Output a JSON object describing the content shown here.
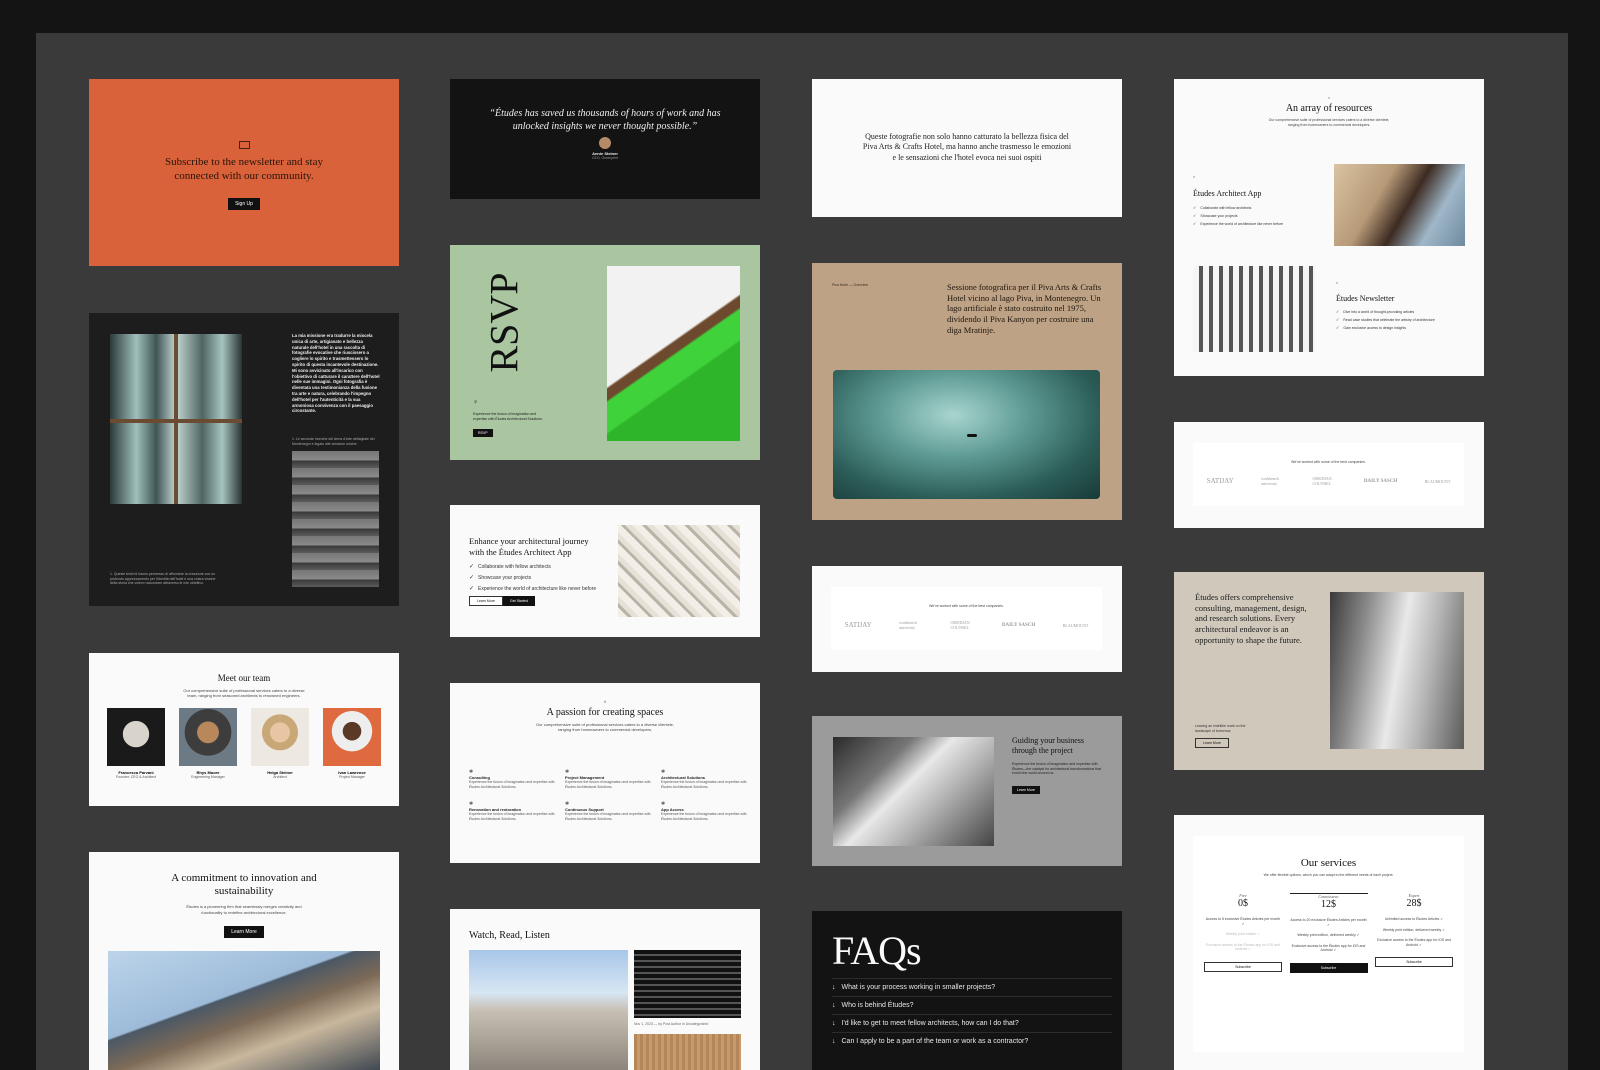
{
  "newsletter": {
    "title": "Subscribe to the newsletter and stay connected with our community.",
    "button": "Sign Up"
  },
  "testimonial": {
    "quote": "“Études has saved us thousands of hours of work and has unlocked insights we never thought possible.”",
    "name": "Annie Steiner",
    "role": "CEO, Greenprint"
  },
  "quote_it": {
    "text": "Queste fotografie non solo hanno catturato la bellezza fisica del Piva Arts & Crafts Hotel, ma hanno anche trasmesso le emozioni e le sensazioni che l'hotel evoca nei suoi ospiti"
  },
  "resources": {
    "title": "An array of resources",
    "subtitle": "Our comprehensive suite of professional services caters to a diverse clientele, ranging from homeowners to commercial developers.",
    "app_title": "Études Architect App",
    "app_items": [
      "Collaborate with fellow architects",
      "Showcase your projects",
      "Experience the world of architecture like never before"
    ],
    "newsletter_title": "Études Newsletter",
    "newsletter_items": [
      "Dive into a world of thought-provoking articles",
      "Read case studies that celebrate the artistry of architecture",
      "Gain exclusive access to design insights"
    ]
  },
  "mission": {
    "text": "La mia missione era tradurre la miscela unica di arte, artigianato e bellezza naturale dell'hotel in una raccolta di fotografie evocative che riuscissero a cogliere lo spirito e trasmettessero lo spirito di questa incantevole destinazione. Mi sono avvicinato all'incarico con l'obiettivo di catturare il carattere dell'hotel nelle sue immagini. Ogni fotografia è diventata una testimonianza della fusione tra arte e natura, celebrando l'impegno dell'hotel per l'autenticità e la sua armoniosa convivenza con il paesaggio circostante.",
    "caption_top": "1. Le seconde ricerche del Arma d'arte dettagliate del Montenegro e legato alle venature uniche.",
    "caption_bottom": "1. Queste testi mi hanno permesso di affrontare la creazione con un profondo apprezzamento per l'identità dell'hotel e una chiara visione della storia che volevo raccontare attraverso le mie obiettivo."
  },
  "rsvp": {
    "title": "RSVP",
    "body": "Experience the fusion of imagination and expertise with Études Architectural Solutions.",
    "button": "RSVP"
  },
  "session": {
    "eyebrow": "Piva Hotel — Overview",
    "text": "Sessione fotografica per il Piva Arts & Crafts Hotel vicino al lago Piva, in Montenegro. Un lago artificiale è stato costruito nel 1975, dividendo il Piva Kanyon per costruire una diga Mratinje."
  },
  "logos_card": {
    "title": "We've worked with some of the best companies.",
    "logos": [
      "SATIJAY",
      "workbench university",
      "OBSIDIAN COUNSEL",
      "DAILY SASCH",
      "BLAUMOUNT"
    ]
  },
  "enhance": {
    "title": "Enhance your architectural journey with the Études Architect App",
    "items": [
      "Collaborate with fellow architects",
      "Showcase your projects",
      "Experience the world of architecture like never before"
    ],
    "learn": "Learn More",
    "start": "Get Started"
  },
  "offers": {
    "text": "Études offers comprehensive consulting, management, design, and research solutions. Every architectural endeavor is an opportunity to shape the future.",
    "note": "Leaving an indelible mark on the landscape of tomorrow.",
    "button": "Learn More"
  },
  "team": {
    "title": "Meet our team",
    "subtitle": "Our comprehensive suite of professional services caters to a diverse team, ranging from seasoned architects to renowned engineers.",
    "members": [
      {
        "name": "Francesca Parvani",
        "role": "Founder, CEO & Architect"
      },
      {
        "name": "Rhys Moore",
        "role": "Engineering Manager"
      },
      {
        "name": "Helga Steiner",
        "role": "Architect"
      },
      {
        "name": "Ivan Lawrence",
        "role": "Project Manager"
      }
    ]
  },
  "passion": {
    "title": "A passion for creating spaces",
    "subtitle": "Our comprehensive suite of professional services caters to a diverse clientele, ranging from homeowners to commercial developers.",
    "services": [
      {
        "name": "Consulting",
        "desc": "Experience the fusion of imagination and expertise with Études Architectural Solutions."
      },
      {
        "name": "Project Management",
        "desc": "Experience the fusion of imagination and expertise with Études Architectural Solutions."
      },
      {
        "name": "Architectural Solutions",
        "desc": "Experience the fusion of imagination and expertise with Études Architectural Solutions."
      },
      {
        "name": "Renovation and restoration",
        "desc": "Experience the fusion of imagination and expertise with Études Architectural Solutions."
      },
      {
        "name": "Continuous Support",
        "desc": "Experience the fusion of imagination and expertise with Études Architectural Solutions."
      },
      {
        "name": "App Access",
        "desc": "Experience the fusion of imagination and expertise with Études Architectural Solutions."
      }
    ]
  },
  "guiding": {
    "title": "Guiding your business through the project",
    "body": "Experience the fusion of imagination and expertise with Études—the catalyst for architectural transformations that enrich the world around us.",
    "button": "Learn More"
  },
  "commitment": {
    "title": "A commitment to innovation and sustainability",
    "body": "Études is a pioneering firm that seamlessly merges creativity and functionality to redefine architectural excellence.",
    "button": "Learn More"
  },
  "watch": {
    "title": "Watch, Read, Listen",
    "caption": "Nov 1, 2023 — by Post Author in Uncategorized"
  },
  "faq": {
    "title": "FAQs",
    "items": [
      "What is your process working in smaller projects?",
      "Who is behind Études?",
      "I'd like to get to meet fellow architects, how can I do that?",
      "Can I apply to be a part of the team or work as a contractor?"
    ]
  },
  "services": {
    "title": "Our services",
    "subtitle": "We offer flexible options, which you can adapt to the different needs of each project.",
    "plans": [
      {
        "name": "Free",
        "price": "0$",
        "f1": "Access to 5 exclusive Études Articles per month ✓",
        "f2": "Weekly print edition ✓",
        "f3": "Exclusive access to the Études app for iOS and Android ✓",
        "button": "Subscribe"
      },
      {
        "name": "Connoisseur",
        "price": "12$",
        "f1": "Access to 20 exclusive Études Articles per month ✓",
        "f2": "Weekly print edition, delivered weekly ✓",
        "f3": "Exclusive access to the Études app for iOS and Android ✓",
        "button": "Subscribe"
      },
      {
        "name": "Expert",
        "price": "28$",
        "f1": "Unlimited access to Études Articles ✓",
        "f2": "Weekly print edition, delivered weekly ✓",
        "f3": "Exclusive access to the Études app for iOS and Android ✓",
        "button": "Subscribe"
      }
    ]
  },
  "colors": {
    "accent": "#d9623a",
    "rsvp_green": "#a9c6a1",
    "sand": "#bda285",
    "stone": "#cfc8bb"
  }
}
